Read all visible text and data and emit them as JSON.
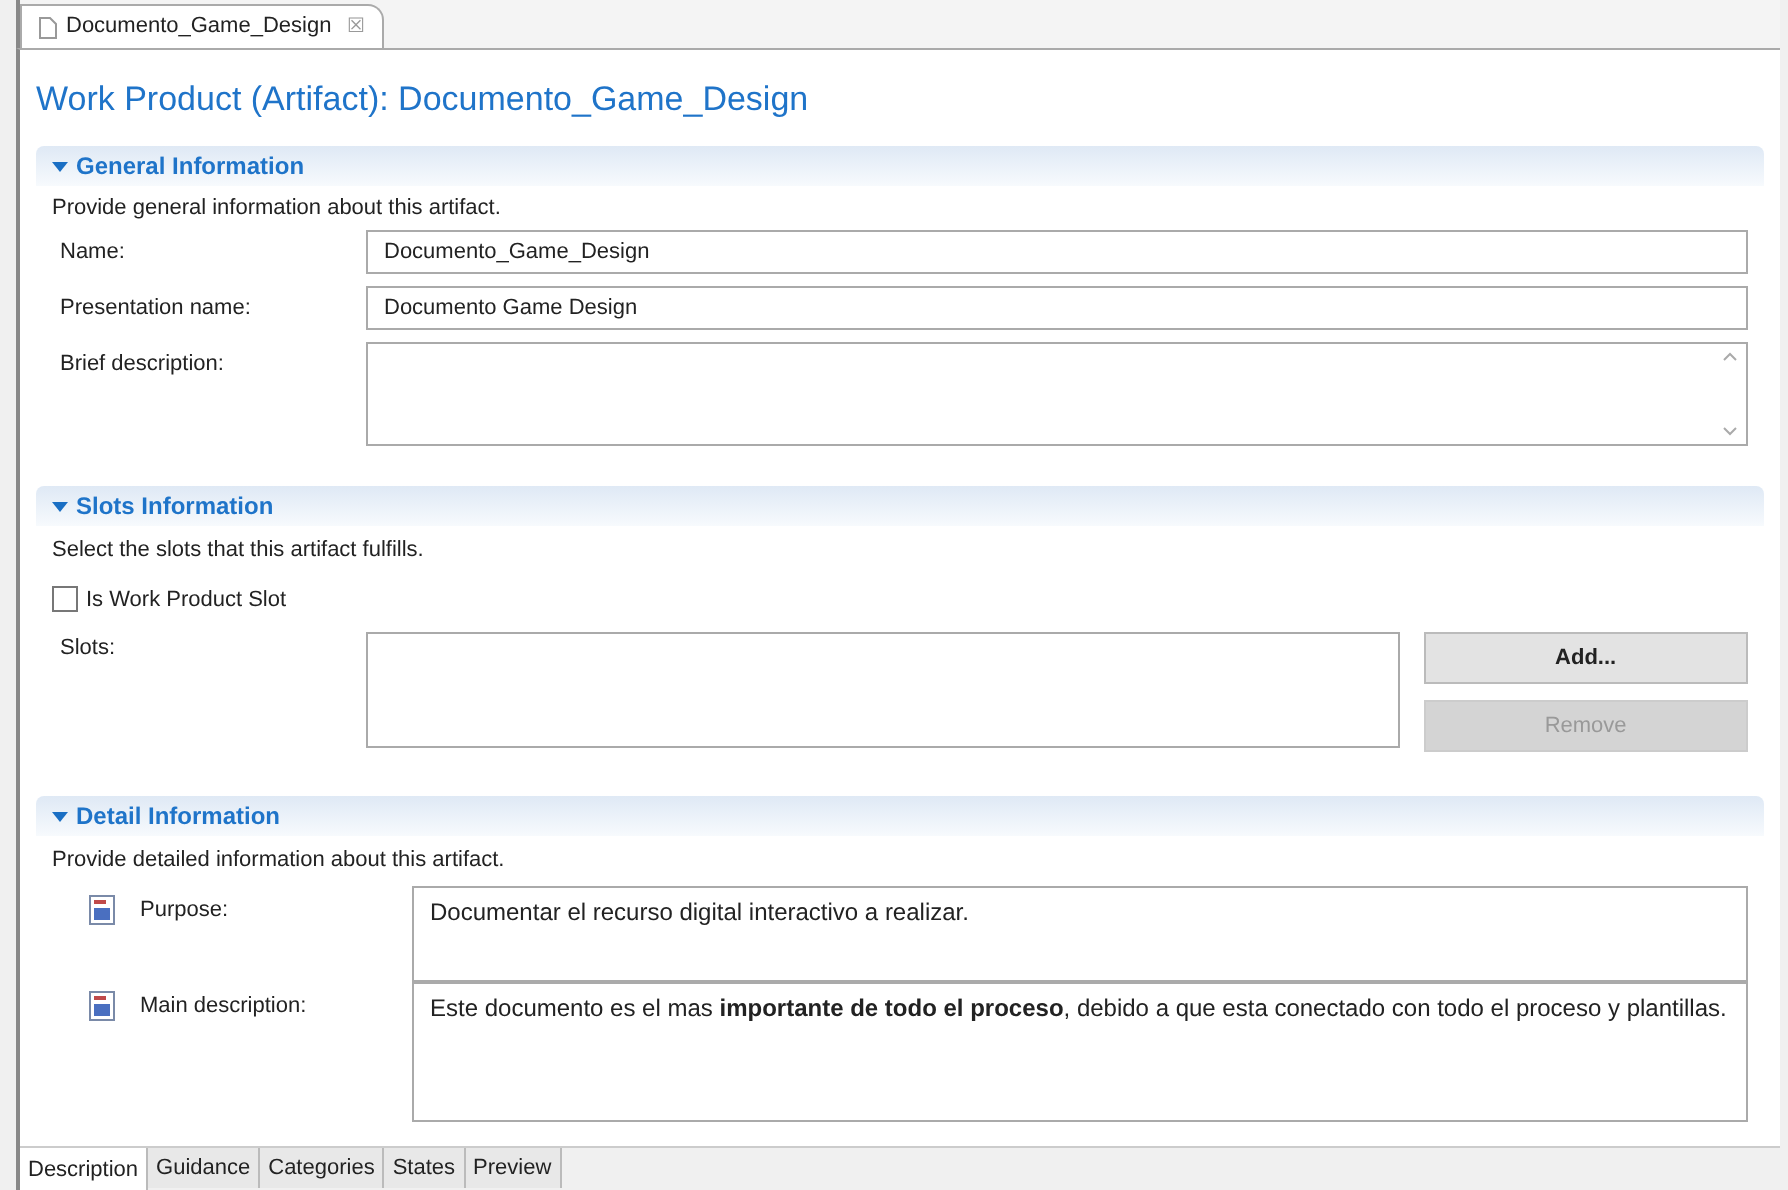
{
  "editor_tab": {
    "title": "Documento_Game_Design",
    "close": "☒"
  },
  "title": "Work Product (Artifact): Documento_Game_Design",
  "general": {
    "header": "General Information",
    "expanded": true,
    "description": "Provide general information about this artifact.",
    "fields": [
      {
        "label": "Name:",
        "kind": "line",
        "value": "Documento_Game_Design"
      },
      {
        "label": "Presentation name:",
        "kind": "line",
        "value": "Documento Game Design"
      },
      {
        "label": "Brief description:",
        "kind": "area"
      }
    ]
  },
  "slots": {
    "header": "Slots Information",
    "expanded": true,
    "description": "Select the slots that this artifact fulfills.",
    "checkbox": {
      "label": "Is Work Product Slot",
      "checked": false
    },
    "slots_label": "Slots:",
    "buttons": [
      {
        "label": "Add...",
        "disabled": false
      },
      {
        "label": "Remove",
        "disabled": true
      }
    ]
  },
  "detail": {
    "header": "Detail Information",
    "expanded": true,
    "description": "Provide detailed information about this artifact.",
    "fields": [
      {
        "label": "Purpose:",
        "value": "Documentar el recurso digital interactivo a realizar."
      },
      {
        "label": "Main description:",
        "value": "Este documento es el mas **importante de todo el proceso**, debido a que esta conectado con todo el proceso y plantillas."
      }
    ]
  },
  "bottom_tabs": [
    {
      "label": "Description",
      "selected": true
    },
    {
      "label": "Guidance",
      "selected": false
    },
    {
      "label": "Categories",
      "selected": false
    },
    {
      "label": "States",
      "selected": false
    },
    {
      "label": "Preview",
      "selected": false
    }
  ]
}
